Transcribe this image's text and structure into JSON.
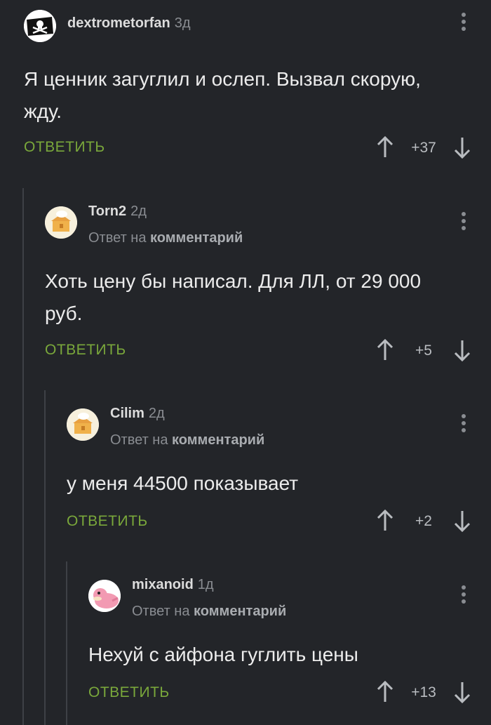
{
  "comments": [
    {
      "username": "dextrometorfan",
      "age": "3д",
      "reply_prefix": "",
      "reply_link": "",
      "text": "Я ценник загуглил и ослеп. Вызвал скорую,\nжду.",
      "reply_label": "ОТВЕТИТЬ",
      "score": "+37",
      "avatar_icon": "pirate-flag-icon"
    },
    {
      "username": "Torn2",
      "age": "2д",
      "reply_prefix": "Ответ на",
      "reply_link": "комментарий",
      "text": "Хоть цену бы написал. Для ЛЛ, от 29 000\nруб.",
      "reply_label": "ОТВЕТИТЬ",
      "score": "+5",
      "avatar_icon": "default-avatar-icon"
    },
    {
      "username": "Cilim",
      "age": "2д",
      "reply_prefix": "Ответ на",
      "reply_link": "комментарий",
      "text": "у меня 44500 показывает",
      "reply_label": "ОТВЕТИТЬ",
      "score": "+2",
      "avatar_icon": "default-avatar-icon"
    },
    {
      "username": "mixanoid",
      "age": "1д",
      "reply_prefix": "Ответ на",
      "reply_link": "комментарий",
      "text": "Нехуй с айфона гуглить цены",
      "reply_label": "ОТВЕТИТЬ",
      "score": "+13",
      "avatar_icon": "slowpoke-avatar-icon"
    }
  ],
  "colors": {
    "background": "#232529",
    "reply_green": "#7aa83b",
    "muted": "#8a8d92"
  }
}
